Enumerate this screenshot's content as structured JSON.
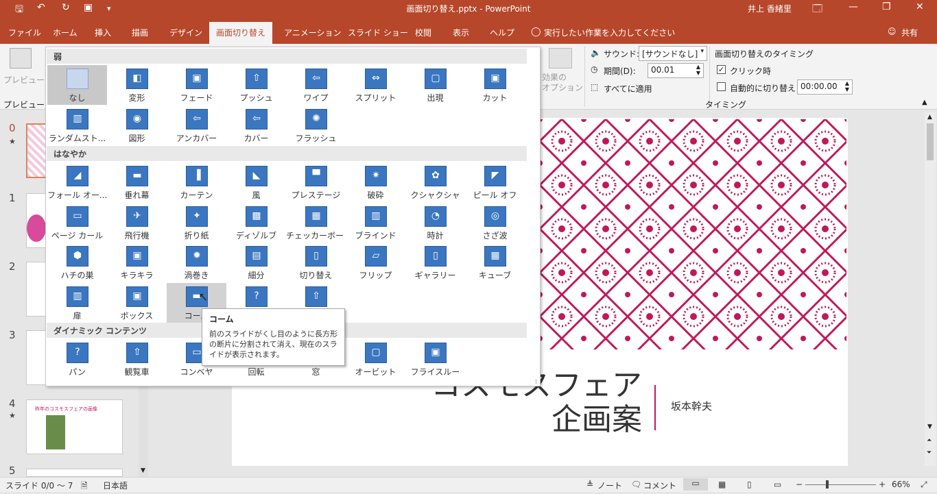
{
  "window": {
    "title": "画面切り替え.pptx - PowerPoint",
    "user": "井上 香緒里",
    "controls": [
      "🗔",
      "—",
      "❐",
      "✕"
    ]
  },
  "quick_access": [
    "🖫",
    "↶",
    "↻",
    "▣",
    "▾"
  ],
  "tabs": [
    "ファイル",
    "ホーム",
    "挿入",
    "描画",
    "デザイン",
    "画面切り替え",
    "アニメーション",
    "スライド ショー",
    "校閲",
    "表示",
    "ヘルプ",
    "実行したい作業を入力してください",
    "共有"
  ],
  "ribbon": {
    "preview_label": "プレビュー",
    "preview_group": "プレビュー",
    "effect_options": "効果の\nオプション",
    "sound_label": "サウンド:",
    "sound_value": "[サウンドなし]",
    "duration_label": "期間(D):",
    "duration_value": "00.01",
    "apply_all": "すべてに適用",
    "timing_title": "画面切り替えのタイミング",
    "on_click": "クリック時",
    "after_label": "自動的に切り替え",
    "after_value": "00:00.00",
    "timing_group": "タイミング"
  },
  "gallery": {
    "sections": [
      "弱",
      "はなやか",
      "ダイナミック コンテンツ"
    ],
    "subtle": [
      "なし",
      "変形",
      "フェード",
      "プッシュ",
      "ワイプ",
      "スプリット",
      "出現",
      "カット",
      "ランダムスト...",
      "図形",
      "アンカバー",
      "カバー",
      "フラッシュ"
    ],
    "exciting": [
      "フォール オー...",
      "垂れ幕",
      "カーテン",
      "風",
      "プレステージ",
      "破砕",
      "クシャクシャ",
      "ピール オフ",
      "ページ カール",
      "飛行機",
      "折り紙",
      "ディゾルブ",
      "チェッカーボード",
      "ブラインド",
      "時計",
      "さざ波",
      "ハチの巣",
      "キラキラ",
      "渦巻き",
      "細分",
      "切り替え",
      "フリップ",
      "ギャラリー",
      "キューブ",
      "扉",
      "ボックス",
      "コーム",
      "",
      ""
    ],
    "dynamic": [
      "パン",
      "観覧車",
      "コンベヤ",
      "回転",
      "窓",
      "オービット",
      "フライスルー"
    ]
  },
  "tooltip": {
    "title": "コーム",
    "desc": "前のスライドがくし目のように長方形の断片に分割されて消え、現在のスライドが表示されます。"
  },
  "thumbnails": {
    "numbers": [
      "0",
      "1",
      "2",
      "3",
      "4",
      "5"
    ],
    "star": "★",
    "thumb4_title": "昨年のコスモスフェアの画像"
  },
  "slide": {
    "title_line1": "コスモスフェア",
    "title_line2": "企画案",
    "author": "坂本幹夫"
  },
  "status": {
    "slide_info": "スライド 0/0 〜 7",
    "language": "日本語",
    "notes": "ノート",
    "comments": "コメント",
    "zoom": "66%"
  },
  "colors": {
    "brand": "#b7472a",
    "pattern": "#c0185a",
    "icon_blue": "#3b77c0"
  }
}
